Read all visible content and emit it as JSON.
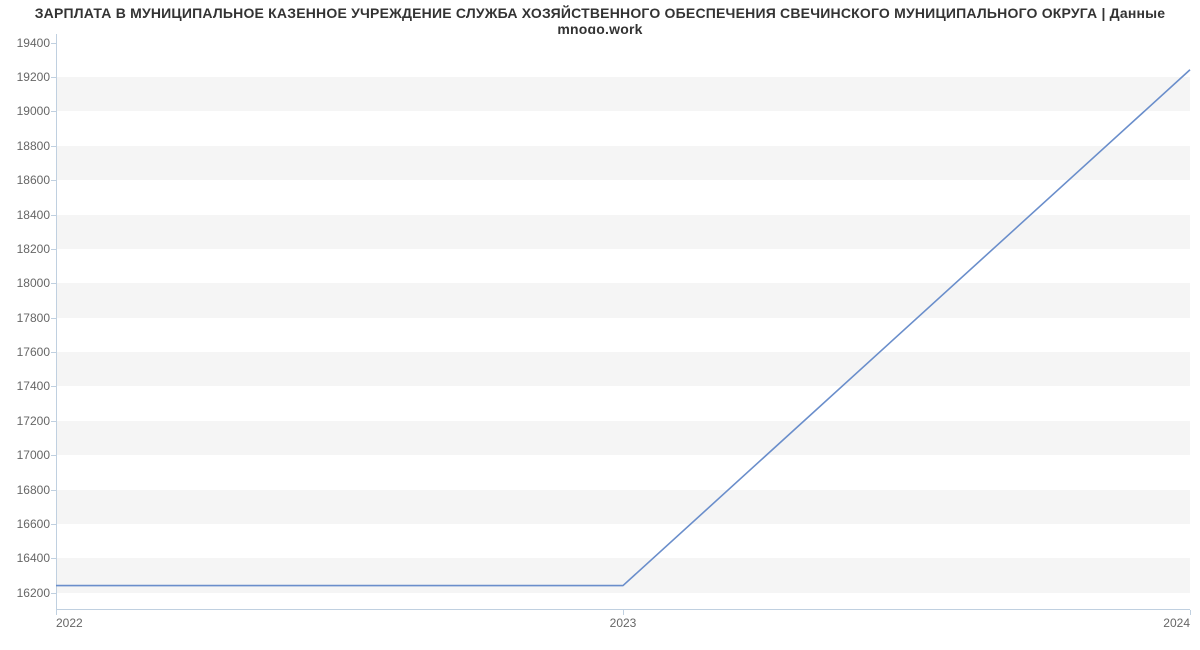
{
  "chart_data": {
    "type": "line",
    "title": "ЗАРПЛАТА В МУНИЦИПАЛЬНОЕ КАЗЕННОЕ УЧРЕЖДЕНИЕ СЛУЖБА ХОЗЯЙСТВЕННОГО ОБЕСПЕЧЕНИЯ СВЕЧИНСКОГО МУНИЦИПАЛЬНОГО ОКРУГА | Данные mnogo.work",
    "x": [
      2022,
      2023,
      2024
    ],
    "x_ticks": [
      "2022",
      "2023",
      "2024"
    ],
    "values": [
      16242,
      16242,
      19242
    ],
    "y_ticks": [
      16200,
      16400,
      16600,
      16800,
      17000,
      17200,
      17400,
      17600,
      17800,
      18000,
      18200,
      18400,
      18600,
      18800,
      19000,
      19200,
      19400
    ],
    "ylim": [
      16100,
      19450
    ],
    "xlim": [
      2022,
      2024
    ],
    "line_color": "#6a8ecb",
    "xlabel": "",
    "ylabel": ""
  }
}
